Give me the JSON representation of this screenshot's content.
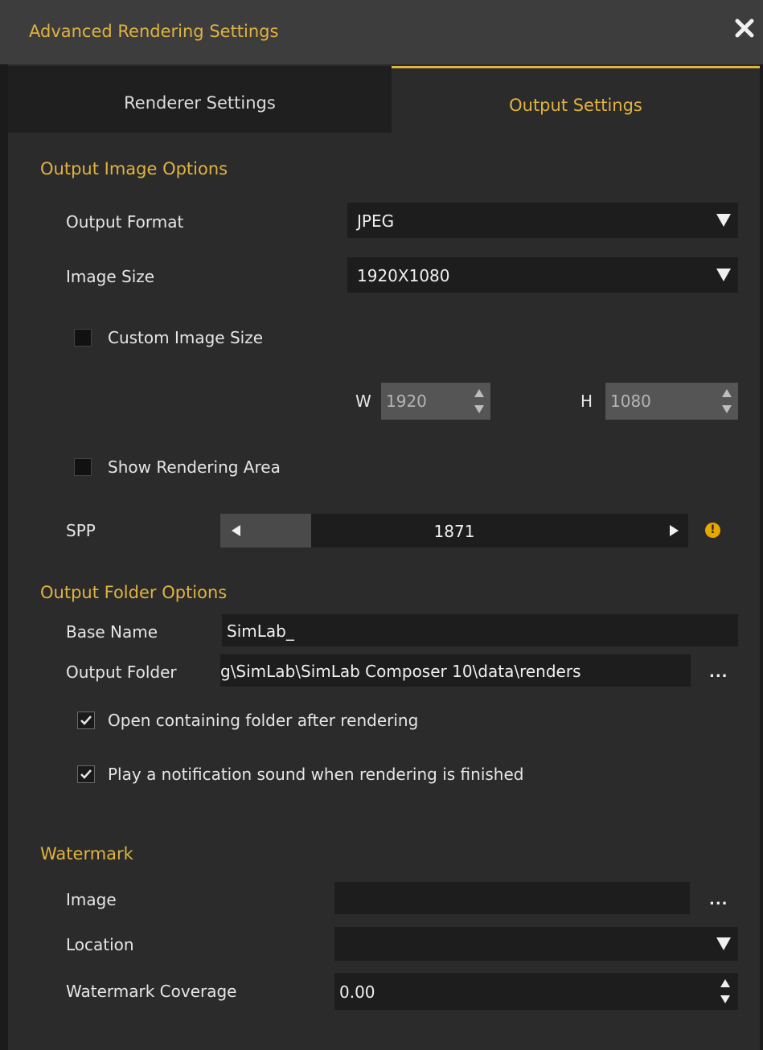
{
  "window": {
    "title": "Advanced Rendering Settings"
  },
  "tabs": [
    {
      "label": "Renderer Settings",
      "active": false
    },
    {
      "label": "Output Settings",
      "active": true
    }
  ],
  "output_image": {
    "section_title": "Output Image Options",
    "format_label": "Output Format",
    "format_value": "JPEG",
    "size_label": "Image Size",
    "size_value": "1920X1080",
    "custom_size_label": "Custom Image Size",
    "custom_size_checked": false,
    "w_label": "W",
    "w_value": "1920",
    "h_label": "H",
    "h_value": "1080",
    "show_area_label": "Show Rendering Area",
    "show_area_checked": false,
    "spp_label": "SPP",
    "spp_value": "1871",
    "info_glyph": "!"
  },
  "output_folder": {
    "section_title": "Output Folder Options",
    "base_name_label": "Base Name",
    "base_name_value": "SimLab_",
    "folder_label": "Output Folder",
    "folder_value": "g\\SimLab\\SimLab Composer 10\\data\\renders",
    "browse_label": "...",
    "open_folder_label": "Open containing folder after rendering",
    "open_folder_checked": true,
    "sound_label": "Play a notification sound when rendering is finished",
    "sound_checked": true
  },
  "watermark": {
    "section_title": "Watermark",
    "image_label": "Image",
    "image_value": "",
    "browse_label": "...",
    "location_label": "Location",
    "location_value": "",
    "coverage_label": "Watermark Coverage",
    "coverage_value": "0.00"
  },
  "colors": {
    "accent": "#e0b340",
    "background": "#2b2b2b",
    "field": "#1d1d1d"
  }
}
